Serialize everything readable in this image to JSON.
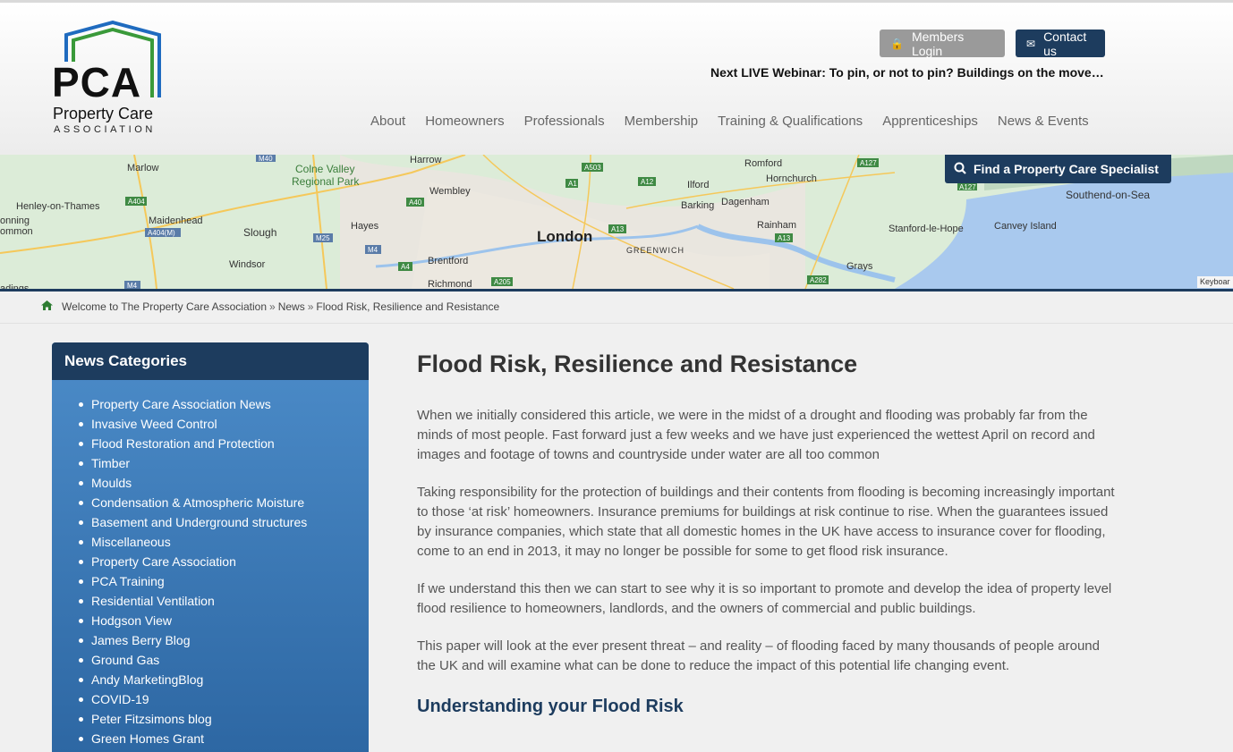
{
  "header": {
    "logo_main": "PCA",
    "logo_sub1": "Property Care",
    "logo_sub2": "ASSOCIATION",
    "members_login": "Members Login",
    "contact_us": "Contact us",
    "webinar": "Next LIVE Webinar: To pin, or not to pin? Buildings on the move…"
  },
  "nav": {
    "items": [
      "About",
      "Homeowners",
      "Professionals",
      "Membership",
      "Training & Qualifications",
      "Apprenticeships",
      "News & Events"
    ]
  },
  "map": {
    "find_button": "Find a Property Care Specialist",
    "keyboard": "Keyboar",
    "labels": [
      "Marlow",
      "Colne Valley",
      "Regional Park",
      "Harrow",
      "Romford",
      "Hornchurch",
      "Henley-on-Thames",
      "Maidenhead",
      "Slough",
      "Hayes",
      "Wembley",
      "London",
      "Ilford",
      "Barking",
      "Dagenham",
      "Rainham",
      "Southend-on-Sea",
      "Canvey Island",
      "Stanford-le-Hope",
      "Windsor",
      "Brentford",
      "Richmond",
      "GREENWICH",
      "Grays",
      "onning",
      "ommon",
      "adings"
    ],
    "roads": [
      "M40",
      "A404",
      "A404(M)",
      "M25",
      "M4",
      "A40",
      "A503",
      "A1",
      "A12",
      "A13",
      "A4",
      "A205",
      "A282",
      "A127",
      "A13",
      "M4",
      "A127"
    ]
  },
  "breadcrumb": {
    "home": "Welcome to The Property Care Association",
    "sep": "»",
    "news": "News",
    "current": "Flood Risk, Resilience and Resistance"
  },
  "sidebar": {
    "title": "News Categories",
    "items": [
      "Property Care Association News",
      "Invasive Weed Control",
      "Flood Restoration and Protection",
      "Timber",
      "Moulds",
      "Condensation & Atmospheric Moisture",
      "Basement and Underground structures",
      "Miscellaneous",
      "Property Care Association",
      "PCA Training",
      "Residential Ventilation",
      "Hodgson View",
      "James Berry Blog",
      "Ground Gas",
      "Andy MarketingBlog",
      "COVID-19",
      "Peter Fitzsimons blog",
      "Green Homes Grant"
    ]
  },
  "article": {
    "title": "Flood Risk, Resilience and Resistance",
    "paragraphs": [
      "When we initially considered this article, we were in the midst of a drought and flooding was probably far from the minds of most people. Fast forward just a few weeks and we have just experienced the wettest April on record and images and footage of towns and countryside under water are all too common",
      "Taking responsibility for the protection of buildings and their contents from flooding is becoming increasingly important to those ‘at risk’ homeowners. Insurance premiums for buildings at risk continue to rise. When the guarantees issued by insurance companies, which state that all domestic homes in the UK have access to insurance cover for flooding, come to an end in 2013, it may no longer be possible for some to get flood risk insurance.",
      "If we understand this then we can start to see why it is so important to promote and develop the idea of property level flood resilience to homeowners, landlords, and the owners of commercial and public buildings.",
      "This paper will look at the ever present threat – and reality – of flooding faced by many thousands of people around the UK and will examine what can be done to reduce the impact of this potential life changing event."
    ],
    "subheading": "Understanding your Flood Risk"
  },
  "colors": {
    "navy": "#1d3c5e",
    "sidebar_top": "#4c8cc9",
    "sidebar_bottom": "#2d67a3",
    "logo_blue": "#1f6bbf",
    "logo_green": "#3a9a3a"
  }
}
